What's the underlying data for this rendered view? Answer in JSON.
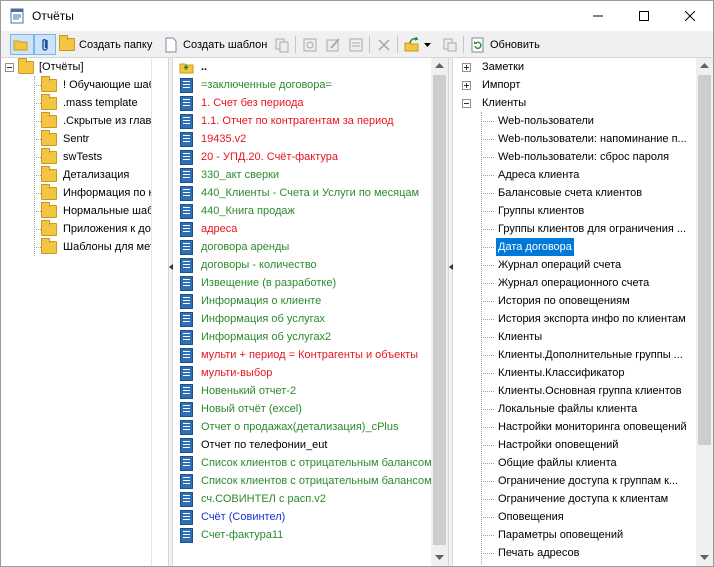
{
  "window": {
    "title": "Отчёты"
  },
  "toolbar": {
    "create_folder": "Создать папку",
    "create_template": "Создать шаблон",
    "refresh": "Обновить"
  },
  "folders": {
    "root": "[Отчёты]",
    "items": [
      "! Обучающие шабло",
      ".mass template",
      ".Скрытые из главно",
      "Sentr",
      "swTests",
      "Детализация",
      "Информация по клие",
      "Нормальные шаблон",
      "Приложения к догов",
      "Шаблоны для метро"
    ]
  },
  "templates": {
    "up": "..",
    "items": [
      {
        "label": "=заключенные договора=",
        "color": "green"
      },
      {
        "label": "1. Счет без периода",
        "color": "red"
      },
      {
        "label": "1.1. Отчет по контрагентам за период",
        "color": "red"
      },
      {
        "label": "19435.v2",
        "color": "red"
      },
      {
        "label": "20 - УПД.20. Счёт-фактура",
        "color": "red"
      },
      {
        "label": "330_акт сверки",
        "color": "green"
      },
      {
        "label": "440_Клиенты - Счета и Услуги по месяцам",
        "color": "green"
      },
      {
        "label": "440_Книга продаж",
        "color": "green"
      },
      {
        "label": "адреса",
        "color": "red"
      },
      {
        "label": "договора аренды",
        "color": "green"
      },
      {
        "label": "договоры - количество",
        "color": "green"
      },
      {
        "label": "Извещение (в разработке)",
        "color": "green"
      },
      {
        "label": "Информация о клиенте",
        "color": "green"
      },
      {
        "label": "Информация об услугах",
        "color": "green"
      },
      {
        "label": "Информация об услугах2",
        "color": "green"
      },
      {
        "label": "мульти + период  = Контрагенты и объекты",
        "color": "red"
      },
      {
        "label": "мульти-выбор",
        "color": "red"
      },
      {
        "label": "Новенький отчет-2",
        "color": "green"
      },
      {
        "label": "Новый отчёт (excel)",
        "color": "green"
      },
      {
        "label": "Отчет о продажах(детализация)_cPlus",
        "color": "green"
      },
      {
        "label": "Отчет по телефонии_eut",
        "color": "black"
      },
      {
        "label": "Список клиентов с отрицательным балансом",
        "color": "green"
      },
      {
        "label": "Список клиентов с отрицательным балансом",
        "color": "green"
      },
      {
        "label": "сч.СОВИНТЕЛ с расп.v2",
        "color": "green"
      },
      {
        "label": "Счёт (Совинтел)",
        "color": "blue"
      },
      {
        "label": "Счет-фактура11",
        "color": "green"
      }
    ]
  },
  "categories": {
    "top": [
      "Заметки",
      "Импорт",
      "Клиенты"
    ],
    "clients_children": [
      "Web-пользователи",
      "Web-пользователи: напоминание п...",
      "Web-пользователи: сброс пароля",
      "Адреса клиента",
      "Балансовые счета клиентов",
      "Группы клиентов",
      "Группы клиентов для ограничения ...",
      "Дата договора",
      "Журнал операций счета",
      "Журнал операционного счета",
      "История по оповещениям",
      "История экспорта инфо по клиентам",
      "Клиенты",
      "Клиенты.Дополнительные группы ...",
      "Клиенты.Классификатор",
      "Клиенты.Основная группа клиентов",
      "Локальные файлы клиента",
      "Настройки мониторинга оповещений",
      "Настройки оповещений",
      "Общие файлы клиента",
      "Ограничение доступа к группам к...",
      "Ограничение доступа к клиентам",
      "Оповещения",
      "Параметры оповещений",
      "Печать адресов"
    ],
    "selected_index": 7
  },
  "colors": {
    "green": "#2d8a2d",
    "red": "#e8141e",
    "blue": "#1a33d8",
    "selection": "#0078d7"
  }
}
